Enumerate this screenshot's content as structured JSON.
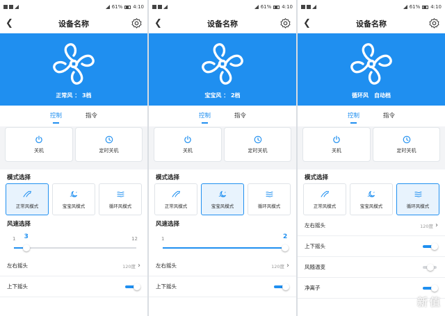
{
  "status_bar": {
    "battery": "61%",
    "time": "4:10"
  },
  "title": "设备名称",
  "tabs": [
    "控制",
    "指令"
  ],
  "controls": {
    "power_label": "关机",
    "timer_label": "定时关机"
  },
  "mode_section_title": "模式选择",
  "modes": [
    "正常风模式",
    "宝宝风模式",
    "循环风模式"
  ],
  "speed_section_title": "风速选择",
  "colors": {
    "accent": "#1f8ff0",
    "hero_bg": "#1f8ff0"
  },
  "icons": [
    "back-icon",
    "gear-icon",
    "fan-logo-icon",
    "power-icon",
    "clock-icon",
    "normal-wind-icon",
    "baby-wind-icon",
    "cycle-wind-icon",
    "chevron-right-icon"
  ],
  "screens": [
    {
      "status_text": "正常风 ： 3档",
      "active_mode": 0,
      "speed": {
        "min": "1",
        "max": "12",
        "current": "3",
        "fraction": 0.1
      },
      "rows": [
        {
          "label": "左右摇头",
          "type": "value",
          "value": "120度"
        },
        {
          "label": "上下摇头",
          "type": "toggle",
          "on": true
        }
      ]
    },
    {
      "status_text": "宝宝风 ： 2档",
      "active_mode": 1,
      "speed": {
        "min": "1",
        "max": "",
        "current": "2",
        "fraction": 1.0
      },
      "rows": [
        {
          "label": "左右摇头",
          "type": "value",
          "value": "120度"
        },
        {
          "label": "上下摇头",
          "type": "toggle",
          "on": true
        }
      ]
    },
    {
      "status_text": "循环风　自动档",
      "active_mode": 2,
      "speed": null,
      "rows": [
        {
          "label": "左右摇头",
          "type": "value",
          "value": "120度"
        },
        {
          "label": "上下摇头",
          "type": "toggle",
          "on": true
        },
        {
          "label": "风随温变",
          "type": "toggle",
          "on": false
        },
        {
          "label": "净离子",
          "type": "toggle",
          "on": true
        }
      ]
    }
  ],
  "watermark": {
    "text": "新",
    "sub": "值",
    "brand": "么值得买"
  }
}
